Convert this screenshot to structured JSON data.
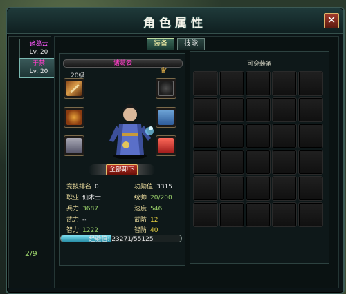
{
  "window": {
    "title": "角色属性",
    "close_icon": "✕"
  },
  "roster": {
    "characters": [
      {
        "name": "诸葛云",
        "level": "Lv. 20",
        "active": false
      },
      {
        "name": "于禁",
        "level": "Lv. 20",
        "active": true
      }
    ],
    "pager": "2/9"
  },
  "tabs": [
    {
      "label": "装备",
      "active": true
    },
    {
      "label": "技能",
      "active": false
    }
  ],
  "character": {
    "name": "诸葛云",
    "level": "20级",
    "unequip_all_label": "全部卸下",
    "slots": [
      {
        "name": "weapon",
        "icon": "sword-icon"
      },
      {
        "name": "bracer",
        "icon": "bracer-icon"
      },
      {
        "name": "boots",
        "icon": "boots-icon"
      },
      {
        "name": "emblem",
        "icon": "emblem-icon"
      },
      {
        "name": "armor",
        "icon": "robe-icon"
      },
      {
        "name": "cape",
        "icon": "cape-icon"
      }
    ],
    "stats": {
      "arena_rank": {
        "label": "竞技排名",
        "value": "0"
      },
      "merit": {
        "label": "功勋值",
        "value": "3315"
      },
      "job": {
        "label": "职业",
        "value": "仙术士"
      },
      "command": {
        "label": "统帅",
        "value": "20/200"
      },
      "troops": {
        "label": "兵力",
        "value": "3687"
      },
      "speed": {
        "label": "速度",
        "value": "546"
      },
      "force": {
        "label": "武力",
        "value": "--"
      },
      "force_def": {
        "label": "武防",
        "value": "12"
      },
      "intellect": {
        "label": "智力",
        "value": "1222"
      },
      "intel_def": {
        "label": "智防",
        "value": "40"
      }
    },
    "experience": {
      "label": "经验值:",
      "value": "23271/55125",
      "fraction": 0.4221
    }
  },
  "inventory": {
    "title": "可穿装备",
    "rows": 6,
    "cols": 5
  },
  "colors": {
    "name_magenta": "#ff3dc8",
    "stat_label": "#f0e0a0",
    "stat_value_green": "#9ad06a",
    "stat_value_yellow": "#e8d040",
    "stat_value_white": "#e8e8e8",
    "pager_green": "#9ad06a"
  }
}
